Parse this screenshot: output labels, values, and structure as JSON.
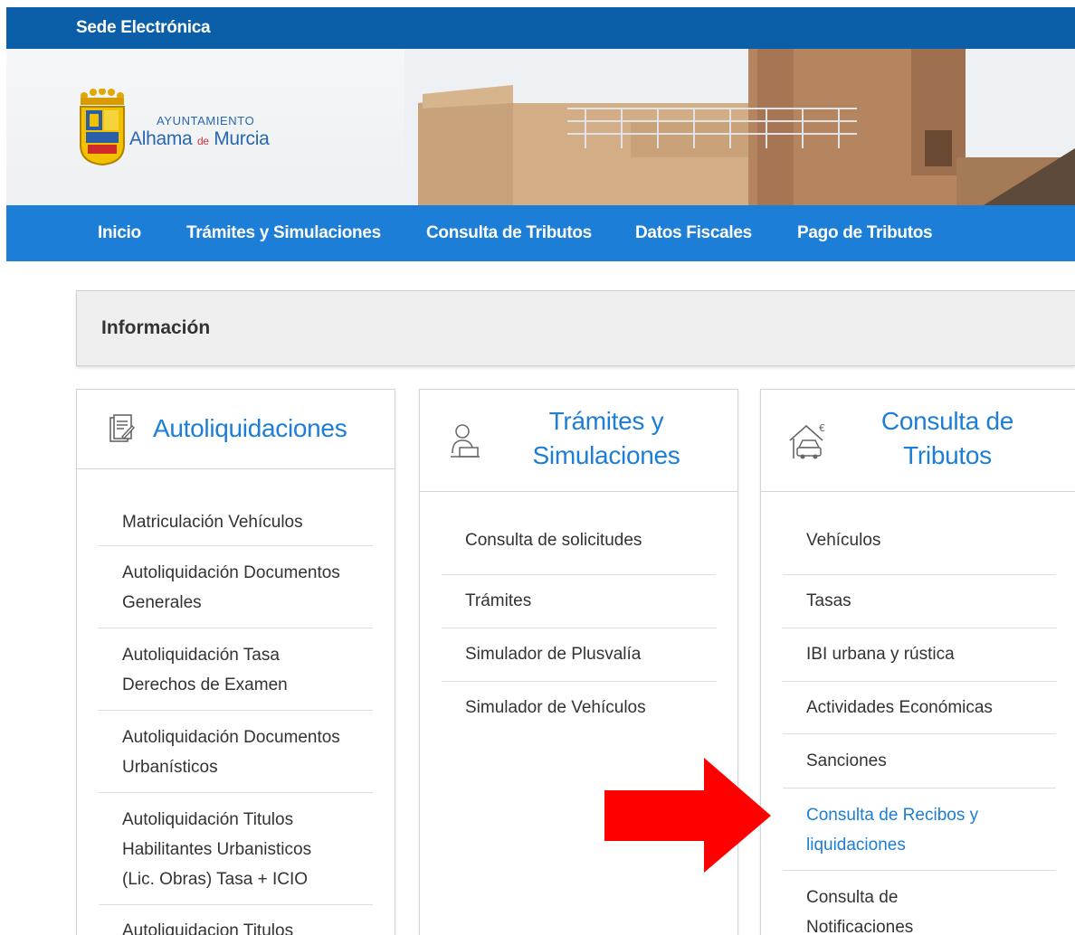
{
  "topbar": {
    "title": "Sede Electrónica"
  },
  "logo": {
    "line1": "AYUNTAMIENTO",
    "line2_a": "Alhama ",
    "line2_de": "de",
    "line2_b": " Murcia"
  },
  "nav": {
    "items": [
      "Inicio",
      "Trámites y Simulaciones",
      "Consulta de Tributos",
      "Datos Fiscales",
      "Pago de Tributos"
    ]
  },
  "info": {
    "title": "Información"
  },
  "cards": [
    {
      "title": "Autoliquidaciones",
      "icon": "document-edit-icon",
      "items": [
        "Matriculación Vehículos",
        "Autoliquidación Documentos Generales",
        "Autoliquidación Tasa Derechos de Examen",
        "Autoliquidación Documentos Urbanísticos",
        "Autoliquidación Titulos Habilitantes Urbanisticos (Lic. Obras) Tasa + ICIO",
        "Autoliquidacion Titulos"
      ]
    },
    {
      "title_line1": "Trámites y",
      "title_line2": "Simulaciones",
      "icon": "person-desk-icon",
      "items": [
        "Consulta de solicitudes",
        "Trámites",
        "Simulador de Plusvalía",
        "Simulador de Vehículos"
      ]
    },
    {
      "title_line1": "Consulta de",
      "title_line2": "Tributos",
      "icon": "house-car-euro-icon",
      "items": [
        "Vehículos",
        "Tasas",
        "IBI urbana y rústica",
        "Actividades Económicas",
        "Sanciones",
        "Consulta de Recibos y liquidaciones",
        "Consulta de Notificaciones"
      ]
    }
  ],
  "colors": {
    "topbar": "#0a5fa8",
    "nav": "#1c7ed6",
    "link": "#1c7ed6",
    "arrow": "#ff0000"
  }
}
